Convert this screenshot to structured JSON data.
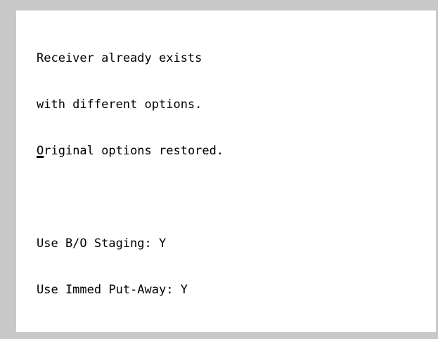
{
  "message": {
    "line1": "Receiver already exists",
    "line2": "with different options.",
    "line3_cursor": "O",
    "line3_rest": "riginal options restored."
  },
  "options": {
    "staging_label": "Use B/O Staging:",
    "staging_value": "Y",
    "putaway_label": "Use Immed Put-Away:",
    "putaway_value": "Y"
  }
}
